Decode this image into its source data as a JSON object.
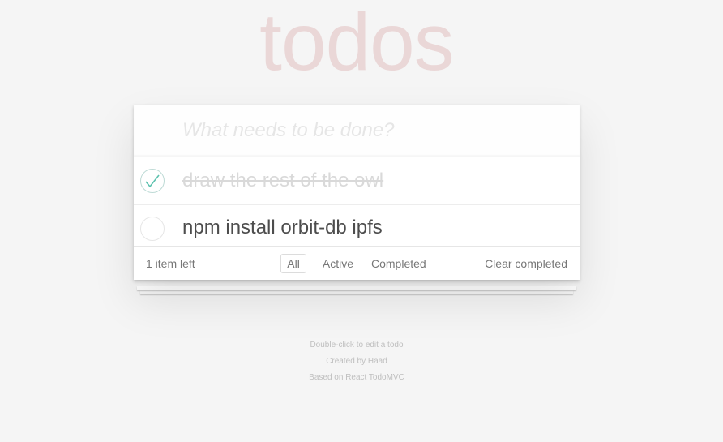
{
  "header": {
    "title": "todos"
  },
  "new_todo": {
    "placeholder": "What needs to be done?"
  },
  "todos": [
    {
      "label": "draw the rest of the owl",
      "completed": true
    },
    {
      "label": "npm install orbit-db ipfs",
      "completed": false
    }
  ],
  "footer": {
    "count_label": "1 item left",
    "filters": [
      "All",
      "Active",
      "Completed"
    ],
    "selected_filter": "All",
    "clear_label": "Clear completed"
  },
  "info": {
    "line1": "Double-click to edit a todo",
    "line2": "Created by Haad",
    "line3": "Based on React TodoMVC"
  },
  "colors": {
    "title": "#ead7d7",
    "check": "#5dc2af",
    "background": "#f5f5f5"
  }
}
